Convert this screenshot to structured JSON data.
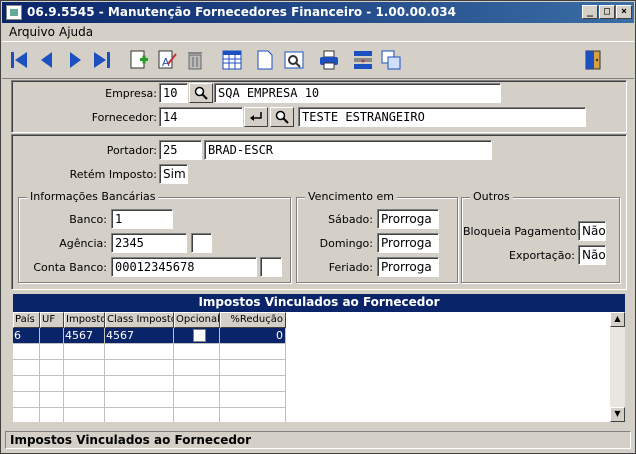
{
  "window": {
    "title": "06.9.5545 - Manutenção Fornecedores Financeiro - 1.00.00.034"
  },
  "menu": {
    "items": [
      "Arquivo",
      "Ajuda"
    ]
  },
  "toolbar": {
    "icons": [
      "first-record-icon",
      "previous-record-icon",
      "next-record-icon",
      "last-record-icon",
      "new-record-icon",
      "edit-record-icon",
      "delete-record-icon",
      "grid-view-icon",
      "document-icon",
      "print-preview-icon",
      "print-icon",
      "export-icon",
      "copy-icon",
      "exit-door-icon"
    ]
  },
  "form": {
    "empresa_label": "Empresa:",
    "empresa_code": "10",
    "empresa_name": "SQA EMPRESA 10",
    "fornecedor_label": "Fornecedor:",
    "fornecedor_code": "14",
    "fornecedor_name": "TESTE ESTRANGEIRO",
    "portador_label": "Portador:",
    "portador_code": "25",
    "portador_name": "BRAD-ESCR",
    "retem_label": "Retém Imposto:",
    "retem_value": "Sim"
  },
  "bancarias": {
    "title": "Informações Bancárias",
    "banco_label": "Banco:",
    "banco_value": "1",
    "agencia_label": "Agência:",
    "agencia_value": "2345",
    "agencia_digit": "",
    "conta_label": "Conta Banco:",
    "conta_value": "00012345678",
    "conta_digit": ""
  },
  "vencimento": {
    "title": "Vencimento em",
    "sabado_label": "Sábado:",
    "sabado_value": "Prorroga",
    "domingo_label": "Domingo:",
    "domingo_value": "Prorroga",
    "feriado_label": "Feriado:",
    "feriado_value": "Prorroga"
  },
  "outros": {
    "title": "Outros",
    "bloqueia_label": "Bloqueia Pagamento:",
    "bloqueia_value": "Não",
    "exportacao_label": "Exportação:",
    "exportacao_value": "Não"
  },
  "grid": {
    "title": "Impostos Vinculados ao Fornecedor",
    "columns": [
      "País",
      "UF",
      "Imposto",
      "Class Imposto",
      "Opcional",
      "%Redução"
    ],
    "rows": [
      {
        "pais": "6",
        "uf": "",
        "imposto": "4567",
        "class": "4567",
        "opcional": "",
        "reducao": "0"
      }
    ]
  },
  "status": {
    "text": "Impostos Vinculados ao Fornecedor"
  },
  "colors": {
    "title_bar": "#0a246a",
    "selection": "#0a246a",
    "window": "#d4d0c8"
  }
}
